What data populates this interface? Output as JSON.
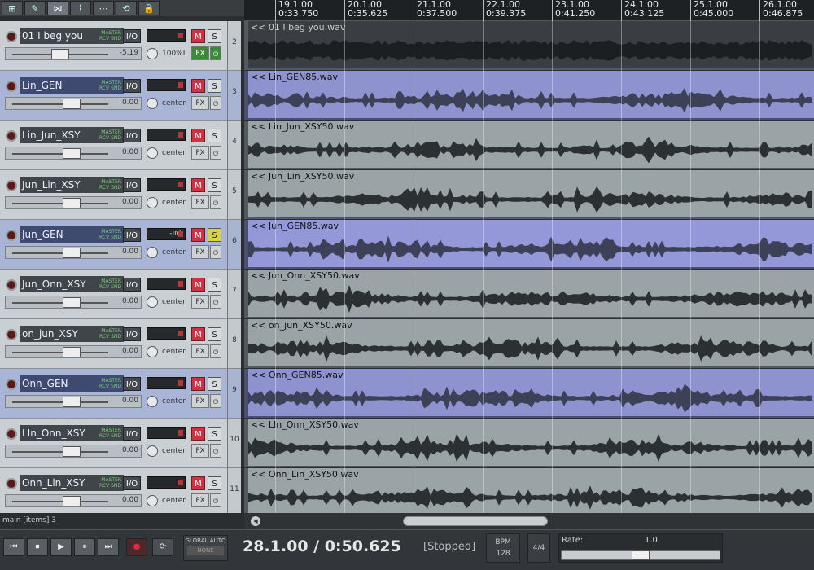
{
  "toolbar": {
    "buttons": [
      {
        "name": "grid-icon",
        "glyph": "⊞"
      },
      {
        "name": "ripple-edit-icon",
        "glyph": "✎"
      },
      {
        "name": "snap-icon",
        "glyph": "⋈"
      },
      {
        "name": "envelope-icon",
        "glyph": "⌇"
      },
      {
        "name": "metronome-icon",
        "glyph": "⋯"
      },
      {
        "name": "loop-icon",
        "glyph": "⟲"
      },
      {
        "name": "lock-icon",
        "glyph": "🔒"
      }
    ]
  },
  "ruler": [
    {
      "bar": "19.1.00",
      "time": "0:33.750"
    },
    {
      "bar": "20.1.00",
      "time": "0:35.625"
    },
    {
      "bar": "21.1.00",
      "time": "0:37.500"
    },
    {
      "bar": "22.1.00",
      "time": "0:39.375"
    },
    {
      "bar": "23.1.00",
      "time": "0:41.250"
    },
    {
      "bar": "24.1.00",
      "time": "0:43.125"
    },
    {
      "bar": "25.1.00",
      "time": "0:45.000"
    },
    {
      "bar": "26.1.00",
      "time": "0:46.875"
    }
  ],
  "tcp_labels": {
    "io": "I/O",
    "mute": "M",
    "solo": "S",
    "fx": "FX",
    "power": "⏻",
    "master_send": "MASTER\nRCV SND"
  },
  "tracks": [
    {
      "num": "2",
      "name": "01 I beg you",
      "meter": "",
      "volume": "-5.19",
      "pan": "100%L",
      "selected": false,
      "solo": false,
      "fx_on": true,
      "item": "<< 01 I beg you.wav"
    },
    {
      "num": "3",
      "name": "Lin_GEN",
      "meter": "",
      "volume": "0.00",
      "pan": "center",
      "selected": true,
      "solo": false,
      "fx_on": false,
      "item": "<< Lin_GEN85.wav"
    },
    {
      "num": "4",
      "name": "Lin_Jun_XSY",
      "meter": "",
      "volume": "0.00",
      "pan": "center",
      "selected": false,
      "solo": false,
      "fx_on": false,
      "item": "<< Lin_Jun_XSY50.wav"
    },
    {
      "num": "5",
      "name": "Jun_Lin_XSY",
      "meter": "",
      "volume": "0.00",
      "pan": "center",
      "selected": false,
      "solo": false,
      "fx_on": false,
      "item": "<< Jun_Lin_XSY50.wav"
    },
    {
      "num": "6",
      "name": "Jun_GEN",
      "meter": "-inf",
      "volume": "0.00",
      "pan": "center",
      "selected": true,
      "solo": true,
      "fx_on": false,
      "item": "<< Jun_GEN85.wav"
    },
    {
      "num": "7",
      "name": "Jun_Onn_XSY",
      "meter": "",
      "volume": "0.00",
      "pan": "center",
      "selected": false,
      "solo": false,
      "fx_on": false,
      "item": "<< Jun_Onn_XSY50.wav"
    },
    {
      "num": "8",
      "name": "on_jun_XSY",
      "meter": "",
      "volume": "0.00",
      "pan": "center",
      "selected": false,
      "solo": false,
      "fx_on": false,
      "item": "<< on_jun_XSY50.wav"
    },
    {
      "num": "9",
      "name": "Onn_GEN",
      "meter": "",
      "volume": "0.00",
      "pan": "center",
      "selected": true,
      "solo": false,
      "fx_on": false,
      "item": "<< Onn_GEN85.wav"
    },
    {
      "num": "10",
      "name": "LIn_Onn_XSY",
      "meter": "",
      "volume": "0.00",
      "pan": "center",
      "selected": false,
      "solo": false,
      "fx_on": false,
      "item": "<< LIn_Onn_XSY50.wav"
    },
    {
      "num": "11",
      "name": "Onn_Lin_XSY",
      "meter": "",
      "volume": "0.00",
      "pan": "center",
      "selected": false,
      "solo": false,
      "fx_on": false,
      "item": "<< Onn_Lin_XSY50.wav"
    }
  ],
  "status": {
    "text": "main [items] 3"
  },
  "transport": {
    "buttons": [
      "⏮",
      "⏹",
      "▶",
      "⏸",
      "⏭"
    ],
    "record": "●",
    "loop": "⟳",
    "global_auto_label": "GLOBAL AUTO",
    "global_auto_value": "NONE",
    "position": "28.1.00 / 0:50.625",
    "state": "[Stopped]",
    "bpm_label": "BPM",
    "bpm_value": "128",
    "time_sig": "4/4",
    "rate_label": "Rate:",
    "rate_value": "1.0"
  },
  "colors": {
    "selected_track": "#a9b5d6",
    "mute": "#cc3344",
    "solo_active": "#d9d242",
    "fx_active": "#3a8a3a"
  }
}
